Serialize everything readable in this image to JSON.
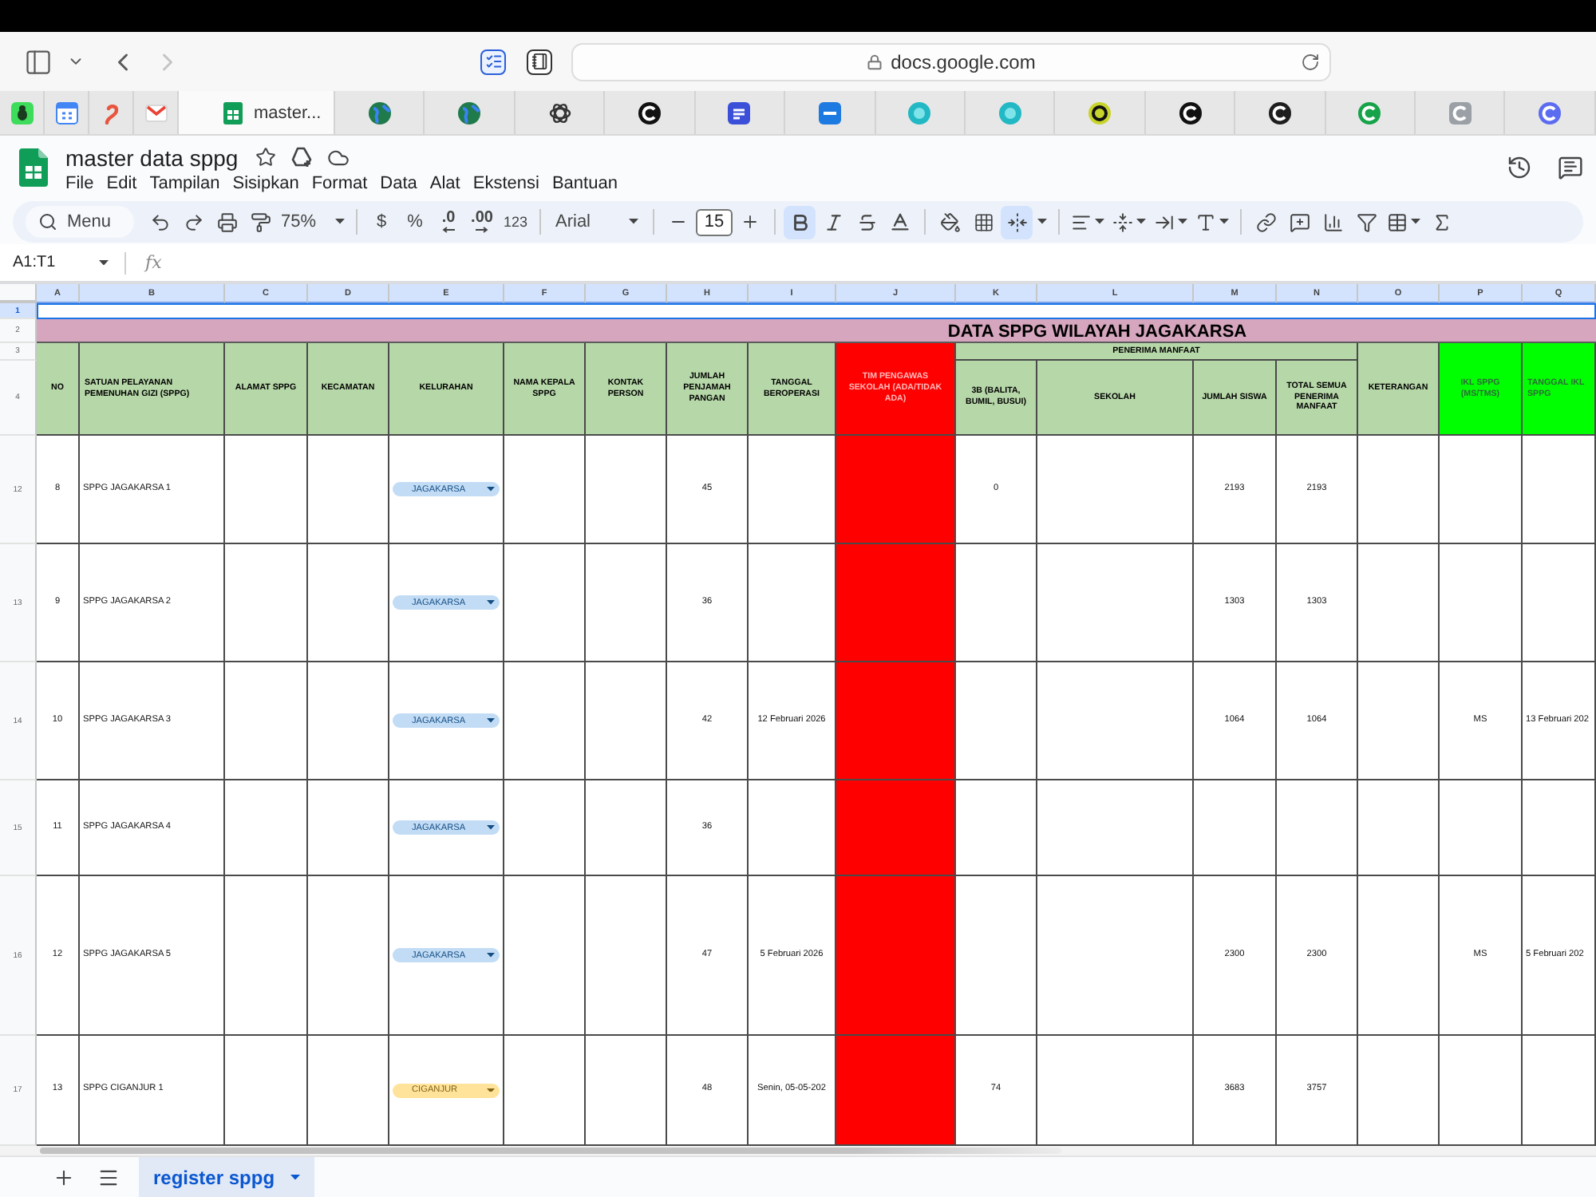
{
  "browser": {
    "back_disabled": false,
    "forward_disabled": true,
    "address": "docs.google.com",
    "tabs": [
      {
        "kind": "pinned",
        "selected": false
      },
      {
        "kind": "pinned",
        "selected": false
      },
      {
        "kind": "pinned",
        "selected": false
      },
      {
        "kind": "pinned",
        "selected": false
      },
      {
        "kind": "page",
        "label": "master...",
        "selected": true
      },
      {
        "kind": "page",
        "selected": false
      },
      {
        "kind": "page",
        "selected": false
      },
      {
        "kind": "page",
        "selected": false
      },
      {
        "kind": "page",
        "selected": false
      },
      {
        "kind": "page",
        "selected": false
      },
      {
        "kind": "page",
        "selected": false
      },
      {
        "kind": "page",
        "selected": false
      },
      {
        "kind": "page",
        "selected": false
      },
      {
        "kind": "page",
        "selected": false
      },
      {
        "kind": "page",
        "selected": false
      },
      {
        "kind": "page",
        "selected": false
      },
      {
        "kind": "page",
        "selected": false
      },
      {
        "kind": "page",
        "selected": false
      },
      {
        "kind": "page",
        "selected": false
      }
    ]
  },
  "document": {
    "title": "master data sppg",
    "menu": [
      "File",
      "Edit",
      "Tampilan",
      "Sisipkan",
      "Format",
      "Data",
      "Alat",
      "Ekstensi",
      "Bantuan"
    ]
  },
  "toolbar": {
    "menu_search": "Menu",
    "zoom": "75%",
    "currency": "$",
    "percent": "%",
    "decimal_decrease": ".0",
    "decimal_increase": ".00",
    "number_format": "123",
    "font": "Arial",
    "font_size": "15",
    "toggles": [
      {
        "kind": "bold",
        "on": true
      },
      {
        "kind": "italic",
        "on": false
      },
      {
        "kind": "strikethrough",
        "on": false
      }
    ],
    "merge_on": true
  },
  "formula_bar": {
    "range": "A1:T1",
    "fx": "fx"
  },
  "sheet": {
    "columns": [
      {
        "letter": "A",
        "selected": true
      },
      {
        "letter": "B",
        "selected": true
      },
      {
        "letter": "C",
        "selected": true
      },
      {
        "letter": "D",
        "selected": true
      },
      {
        "letter": "E",
        "selected": true
      },
      {
        "letter": "F",
        "selected": true
      },
      {
        "letter": "G",
        "selected": true
      },
      {
        "letter": "H",
        "selected": true
      },
      {
        "letter": "I",
        "selected": true
      },
      {
        "letter": "J",
        "selected": true
      },
      {
        "letter": "K",
        "selected": true
      },
      {
        "letter": "L",
        "selected": true
      },
      {
        "letter": "M",
        "selected": true
      },
      {
        "letter": "N",
        "selected": true
      },
      {
        "letter": "O",
        "selected": true
      },
      {
        "letter": "P",
        "selected": true
      },
      {
        "letter": "Q",
        "selected": true
      }
    ],
    "top_rows": [
      {
        "number": "1",
        "selected": true
      },
      {
        "number": "2",
        "selected": false
      },
      {
        "number": "3",
        "selected": false
      },
      {
        "number": "4",
        "selected": false
      }
    ],
    "title": "DATA SPPG WILAYAH JAGAKARSA",
    "headers": [
      {
        "kind": "normal",
        "text": "NO"
      },
      {
        "kind": "normal",
        "text": "SATUAN PELAYANAN PEMENUHAN GIZI (SPPG)"
      },
      {
        "kind": "normal",
        "text": "ALAMAT SPPG"
      },
      {
        "kind": "normal",
        "text": "KECAMATAN"
      },
      {
        "kind": "normal",
        "text": "KELURAHAN"
      },
      {
        "kind": "normal",
        "text": "NAMA KEPALA SPPG"
      },
      {
        "kind": "normal",
        "text": "KONTAK PERSON"
      },
      {
        "kind": "normal",
        "text": "JUMLAH PENJAMAH PANGAN"
      },
      {
        "kind": "normal",
        "text": "TANGGAL BEROPERASI"
      },
      {
        "kind": "alert",
        "text": "TIM PENGAWAS SEKOLAH (ADA/TIDAK ADA)"
      },
      {
        "kind": "normal",
        "text": "PENERIMA MANFAAT",
        "children": [
          {
            "text": "3B (BALITA, BUMIL, BUSUI)"
          },
          {
            "text": "SEKOLAH"
          },
          {
            "text": "JUMLAH SISWA"
          },
          {
            "text": "TOTAL SEMUA PENERIMA MANFAAT"
          }
        ]
      },
      {
        "kind": "normal",
        "text": "KETERANGAN"
      },
      {
        "kind": "check",
        "text": "IKL SPPG (MS/TMS)"
      },
      {
        "kind": "check",
        "text": "TANGGAL IKL SPPG"
      }
    ],
    "rows": [
      {
        "number": "12",
        "selected": false,
        "no": "8",
        "sppg": "SPPG JAGAKARSA 1",
        "kelurahan": {
          "label": "JAGAKARSA",
          "color": "#c2dcf5"
        },
        "jumlah_penjamah_pangan": "45",
        "penerima_3b": "0",
        "jumlah_siswa": "2193",
        "total_penerima": "2193"
      },
      {
        "number": "13",
        "selected": false,
        "no": "9",
        "sppg": "SPPG JAGAKARSA 2",
        "kelurahan": {
          "label": "JAGAKARSA",
          "color": "#c2dcf5"
        },
        "jumlah_penjamah_pangan": "36",
        "jumlah_siswa": "1303",
        "total_penerima": "1303"
      },
      {
        "number": "14",
        "selected": false,
        "no": "10",
        "sppg": "SPPG JAGAKARSA 3",
        "kelurahan": {
          "label": "JAGAKARSA",
          "color": "#c2dcf5"
        },
        "jumlah_penjamah_pangan": "42",
        "tanggal_beroperasi": "12 Februari 2026",
        "jumlah_siswa": "1064",
        "total_penerima": "1064",
        "ikl_sppg": "MS",
        "tanggal_ikl_sppg": "13 Februari 202"
      },
      {
        "number": "15",
        "selected": false,
        "no": "11",
        "sppg": "SPPG JAGAKARSA 4",
        "kelurahan": {
          "label": "JAGAKARSA",
          "color": "#c2dcf5"
        },
        "jumlah_penjamah_pangan": "36"
      },
      {
        "number": "16",
        "selected": false,
        "no": "12",
        "sppg": "SPPG JAGAKARSA 5",
        "kelurahan": {
          "label": "JAGAKARSA",
          "color": "#c2dcf5"
        },
        "jumlah_penjamah_pangan": "47",
        "tanggal_beroperasi": "5 Februari 2026",
        "jumlah_siswa": "2300",
        "total_penerima": "2300",
        "ikl_sppg": "MS",
        "tanggal_ikl_sppg": "5 Februari 202"
      },
      {
        "number": "17",
        "selected": false,
        "no": "13",
        "sppg": "SPPG CIGANJUR 1",
        "kelurahan": {
          "label": "CIGANJUR",
          "color": "#ffe39a"
        },
        "jumlah_penjamah_pangan": "48",
        "tanggal_beroperasi": "Senin, 05-05-202",
        "penerima_3b": "74",
        "jumlah_siswa": "3683",
        "total_penerima": "3757"
      }
    ]
  },
  "sheet_tabs": [
    {
      "label": "register sppg",
      "selected": true
    }
  ]
}
